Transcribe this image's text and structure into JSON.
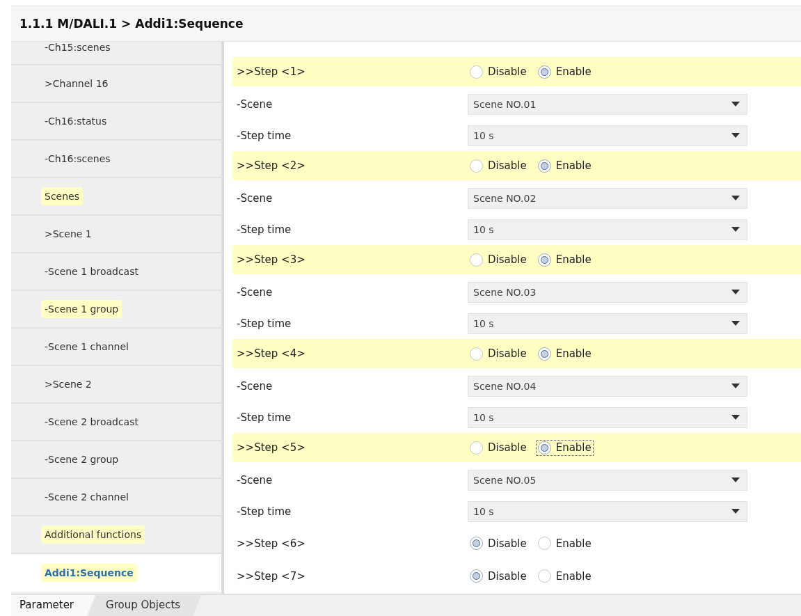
{
  "header": {
    "title": "1.1.1 M/DALI.1 > Addi1:Sequence"
  },
  "sidebar": {
    "items": [
      {
        "label": "-Ch15:scenes",
        "highlighted": false,
        "selected": false
      },
      {
        "label": ">Channel 16",
        "highlighted": false,
        "selected": false
      },
      {
        "label": "-Ch16:status",
        "highlighted": false,
        "selected": false
      },
      {
        "label": "-Ch16:scenes",
        "highlighted": false,
        "selected": false
      },
      {
        "label": "Scenes",
        "highlighted": true,
        "selected": false
      },
      {
        "label": ">Scene 1",
        "highlighted": false,
        "selected": false
      },
      {
        "label": "-Scene 1 broadcast",
        "highlighted": false,
        "selected": false
      },
      {
        "label": "-Scene 1 group",
        "highlighted": true,
        "selected": false
      },
      {
        "label": "-Scene 1 channel",
        "highlighted": false,
        "selected": false
      },
      {
        "label": ">Scene 2",
        "highlighted": false,
        "selected": false
      },
      {
        "label": "-Scene 2 broadcast",
        "highlighted": false,
        "selected": false
      },
      {
        "label": "-Scene 2 group",
        "highlighted": false,
        "selected": false
      },
      {
        "label": "-Scene 2 channel",
        "highlighted": false,
        "selected": false
      },
      {
        "label": "Additional functions",
        "highlighted": true,
        "selected": false
      },
      {
        "label": "Addi1:Sequence",
        "highlighted": true,
        "selected": true
      }
    ]
  },
  "steps": [
    {
      "label": ">>Step <1>",
      "highlighted": true,
      "options": [
        {
          "label": "Disable",
          "selected": false,
          "focused": false
        },
        {
          "label": "Enable",
          "selected": true,
          "focused": false
        }
      ],
      "fields": [
        {
          "label": "-Scene",
          "value": "Scene NO.01"
        },
        {
          "label": "-Step time",
          "value": "10 s"
        }
      ]
    },
    {
      "label": ">>Step <2>",
      "highlighted": true,
      "options": [
        {
          "label": "Disable",
          "selected": false,
          "focused": false
        },
        {
          "label": "Enable",
          "selected": true,
          "focused": false
        }
      ],
      "fields": [
        {
          "label": "-Scene",
          "value": "Scene NO.02"
        },
        {
          "label": "-Step time",
          "value": "10 s"
        }
      ]
    },
    {
      "label": ">>Step <3>",
      "highlighted": true,
      "options": [
        {
          "label": "Disable",
          "selected": false,
          "focused": false
        },
        {
          "label": "Enable",
          "selected": true,
          "focused": false
        }
      ],
      "fields": [
        {
          "label": "-Scene",
          "value": "Scene NO.03"
        },
        {
          "label": "-Step time",
          "value": "10 s"
        }
      ]
    },
    {
      "label": ">>Step <4>",
      "highlighted": true,
      "options": [
        {
          "label": "Disable",
          "selected": false,
          "focused": false
        },
        {
          "label": "Enable",
          "selected": true,
          "focused": false
        }
      ],
      "fields": [
        {
          "label": "-Scene",
          "value": "Scene NO.04"
        },
        {
          "label": "-Step time",
          "value": "10 s"
        }
      ]
    },
    {
      "label": ">>Step <5>",
      "highlighted": true,
      "options": [
        {
          "label": "Disable",
          "selected": false,
          "focused": false
        },
        {
          "label": "Enable",
          "selected": true,
          "focused": true
        }
      ],
      "fields": [
        {
          "label": "-Scene",
          "value": "Scene NO.05"
        },
        {
          "label": "-Step time",
          "value": "10 s"
        }
      ]
    },
    {
      "label": ">>Step <6>",
      "highlighted": false,
      "options": [
        {
          "label": "Disable",
          "selected": true,
          "focused": false
        },
        {
          "label": "Enable",
          "selected": false,
          "focused": false
        }
      ]
    },
    {
      "label": ">>Step <7>",
      "highlighted": false,
      "options": [
        {
          "label": "Disable",
          "selected": true,
          "focused": false
        },
        {
          "label": "Enable",
          "selected": false,
          "focused": false
        }
      ]
    }
  ],
  "tabs": [
    {
      "label": "Parameter",
      "selected": true
    },
    {
      "label": "Group Objects",
      "selected": false
    }
  ]
}
